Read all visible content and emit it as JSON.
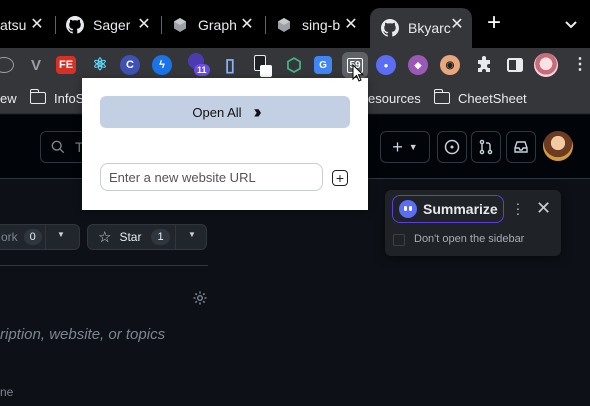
{
  "tabs": [
    {
      "title": "atsu",
      "icon": "generic-page-icon"
    },
    {
      "title": "Sager",
      "icon": "github-icon"
    },
    {
      "title": "Graph",
      "icon": "cube-icon"
    },
    {
      "title": "sing-b",
      "icon": "cube-icon"
    },
    {
      "title": "Bkyarc",
      "icon": "github-icon",
      "active": true
    }
  ],
  "toolbar": {
    "extensions": [
      {
        "name": "ext-vue-icon",
        "label": "V",
        "color": "#9aa0a6"
      },
      {
        "name": "ext-fe-icon",
        "label": "FE",
        "color": "#d93025"
      },
      {
        "name": "ext-react-icon",
        "label": "⚛",
        "color": "#61dafb"
      },
      {
        "name": "ext-c-icon",
        "label": "C",
        "color": "#3f51b5"
      },
      {
        "name": "ext-bolt-icon",
        "label": "ϟ",
        "color": "#2b9be8"
      },
      {
        "name": "ext-badge-icon",
        "label": "11",
        "color": "#6b4ce6"
      },
      {
        "name": "ext-docs-icon",
        "label": "▯",
        "color": "#8ab4f8"
      },
      {
        "name": "ext-tool-icon",
        "label": "◧",
        "color": "#5f6368"
      },
      {
        "name": "ext-vue-devtools-icon",
        "label": "⬡",
        "color": "#41b883"
      },
      {
        "name": "ext-translate-icon",
        "label": "G",
        "color": "#4285f4"
      },
      {
        "name": "ext-bookmark-tabs-icon",
        "label": "59",
        "color": "#5f6368"
      },
      {
        "name": "ext-sider-icon",
        "label": "●",
        "color": "#5b6cf5"
      },
      {
        "name": "ext-purple-icon",
        "label": "◆",
        "color": "#9b59b6"
      },
      {
        "name": "ext-glasses-icon",
        "label": "◉",
        "color": "#e8a87c"
      }
    ]
  },
  "bookmarks": [
    {
      "label": "ew",
      "folder": false
    },
    {
      "label": "InfoS",
      "folder": true
    },
    {
      "label": "esources",
      "folder": false
    },
    {
      "label": "CheetSheet",
      "folder": true
    }
  ],
  "github": {
    "search_prefix": "T",
    "buttons": {
      "fork_label": "ork",
      "fork_count": "0",
      "star_label": "Star",
      "star_count": "1"
    },
    "description_placeholder": "ription, website, or topics",
    "last_line": "ne"
  },
  "popup": {
    "open_all_label": "Open All",
    "url_placeholder": "Enter a new website URL",
    "url_value": ""
  },
  "summarize": {
    "button_label": "Summarize",
    "checkbox_label": "Don't open the sidebar"
  }
}
